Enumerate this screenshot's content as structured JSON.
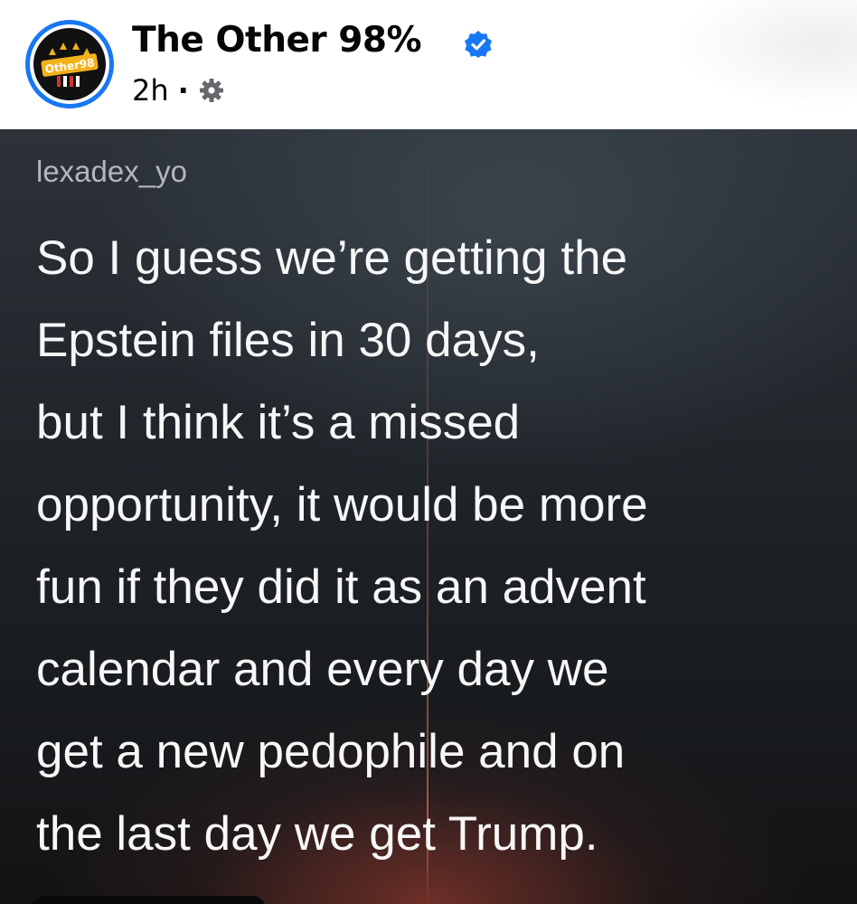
{
  "header": {
    "page_name": "The Other 98%",
    "timestamp": "2h",
    "separator": "·",
    "avatar_text": "Other98",
    "verified_color": "#1877f2",
    "icons": [
      "verified-badge-icon",
      "audience-gear-icon"
    ]
  },
  "post_image": {
    "username": "lexadex_yo",
    "quote": "So I guess we’re getting the\nEpstein files in 30 days,\nbut I think it’s a missed\nopportunity, it would be more\nfun if they did it as an advent\ncalendar and every day we\nget a new pedophile and on\nthe last day we get Trump."
  }
}
